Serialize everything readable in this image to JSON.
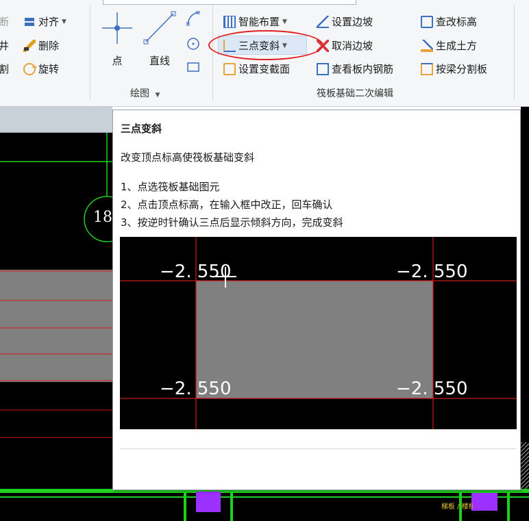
{
  "ribbon": {
    "modify_group": {
      "partial_items": [
        "断",
        "井",
        "割"
      ],
      "align_label": "对齐",
      "delete_label": "删除",
      "rotate_label": "旋转"
    },
    "draw_group": {
      "label": "绘图",
      "point_label": "点",
      "line_label": "直线"
    },
    "raft_group": {
      "label": "筏板基础二次编辑",
      "smart_layout_label": "智能布置",
      "set_slope_label": "设置边坡",
      "check_elevation_label": "查改标高",
      "three_point_slope_label": "三点变斜",
      "cancel_slope_label": "取消边坡",
      "generate_earthwork_label": "生成土方",
      "set_section_label": "设置变截面",
      "view_rebar_label": "查看板内钢筋",
      "split_by_beam_label": "按梁分割板"
    }
  },
  "tooltip": {
    "title": "三点变斜",
    "description": "改变顶点标高使筏板基础变斜",
    "steps": [
      "1、点选筏板基础图元",
      "2、点击顶点标高，在输入框中改正，回车确认",
      "3、按逆时针确认三点后显示倾斜方向，完成变斜"
    ],
    "preview": {
      "elevation_top_left": "−2. 550",
      "elevation_top_right": "−2. 550",
      "elevation_bottom_left": "−2. 550",
      "elevation_bottom_right": "−2. 550"
    }
  },
  "canvas": {
    "axis_number": "18",
    "bottom_label": "梯板 / 楼梯"
  },
  "colors": {
    "highlight_ellipse": "#e02020",
    "cad_background": "#000000",
    "cad_green": "#1fd11f",
    "cad_red": "#d01818",
    "slab_fill": "#808080"
  }
}
